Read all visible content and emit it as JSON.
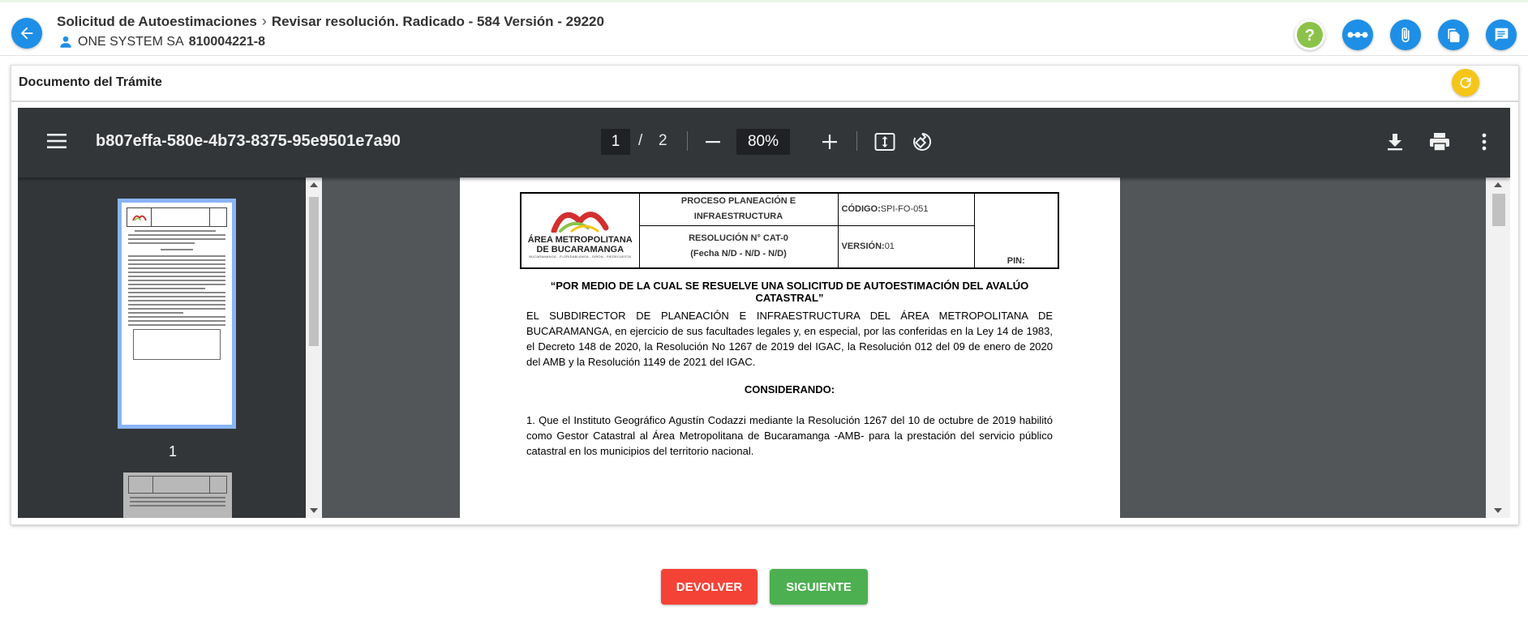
{
  "header": {
    "breadcrumb_root": "Solicitud de Autoestimaciones",
    "breadcrumb_current": "Revisar resolución. Radicado - 584 Versión - 29220",
    "company_name": "ONE SYSTEM SA",
    "company_nit": "810004221-8",
    "icons": [
      "help-icon",
      "more-horizontal-icon",
      "attachment-icon",
      "documents-icon",
      "comments-icon"
    ],
    "accent_color": "#1e8fe6",
    "help_color": "#8bc34a"
  },
  "card": {
    "title": "Documento del Trámite"
  },
  "viewer": {
    "file_name": "b807effa-580e-4b73-8375-95e9501e7a90",
    "current_page": "1",
    "page_separator": "/",
    "total_pages": "2",
    "zoom": "80%",
    "thumb_label": "1"
  },
  "document": {
    "logo_line1": "ÁREA METROPOLITANA",
    "logo_line2": "DE BUCARAMANGA",
    "logo_tagline": "BUCARAMANGA - FLORIDABLANCA - GIRÓN - PIEDECUESTA",
    "process_title": "PROCESO PLANEACIÓN E INFRAESTRUCTURA",
    "resolution_title": "RESOLUCIÓN N° CAT-0",
    "resolution_date": "(Fecha N/D - N/D - N/D)",
    "code_label": "CÓDIGO:",
    "code_value": "SPI-FO-051",
    "version_label": "VERSIÓN:",
    "version_value": "01",
    "pin_label": "PIN:",
    "title": "“POR MEDIO DE LA CUAL SE RESUELVE UNA SOLICITUD DE AUTOESTIMACIÓN DEL AVALÚO CATASTRAL”",
    "paragraph1": "EL SUBDIRECTOR DE PLANEACIÓN E INFRAESTRUCTURA DEL ÁREA METROPOLITANA DE BUCARAMANGA, en ejercicio de sus facultades legales y, en especial, por las conferidas en la Ley 14 de 1983, el Decreto 148 de 2020, la Resolución No 1267 de 2019 del IGAC, la Resolución 012 del 09 de enero de 2020 del AMB y la Resolución 1149 de 2021 del IGAC.",
    "considerando": "CONSIDERANDO:",
    "paragraph2": "1. Que el Instituto Geográfico Agustín Codazzi mediante la Resolución 1267 del 10 de octubre de 2019 habilitó como Gestor Catastral al Área Metropolitana de Bucaramanga -AMB- para la prestación del servicio público catastral en los municipios del territorio nacional."
  },
  "actions": {
    "return_label": "DEVOLVER",
    "next_label": "SIGUIENTE",
    "return_color": "#f44336",
    "next_color": "#4caf50"
  }
}
